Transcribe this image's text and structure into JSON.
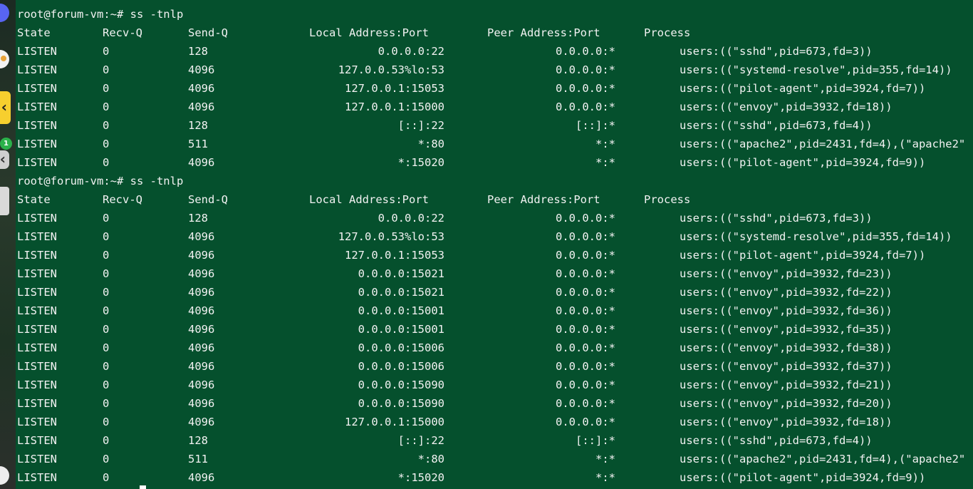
{
  "prompt": "root@forum-vm:~# ",
  "commands": [
    {
      "command": "ss -tnlp",
      "headers": [
        "State",
        "Recv-Q",
        "Send-Q",
        "Local Address:Port",
        "Peer Address:Port",
        "Process"
      ],
      "rows": [
        [
          "LISTEN",
          "0",
          "128",
          "0.0.0.0:22",
          "0.0.0.0:*",
          "users:((\"sshd\",pid=673,fd=3))"
        ],
        [
          "LISTEN",
          "0",
          "4096",
          "127.0.0.53%lo:53",
          "0.0.0.0:*",
          "users:((\"systemd-resolve\",pid=355,fd=14))"
        ],
        [
          "LISTEN",
          "0",
          "4096",
          "127.0.0.1:15053",
          "0.0.0.0:*",
          "users:((\"pilot-agent\",pid=3924,fd=7))"
        ],
        [
          "LISTEN",
          "0",
          "4096",
          "127.0.0.1:15000",
          "0.0.0.0:*",
          "users:((\"envoy\",pid=3932,fd=18))"
        ],
        [
          "LISTEN",
          "0",
          "128",
          "[::]:22",
          "[::]:*",
          "users:((\"sshd\",pid=673,fd=4))"
        ],
        [
          "LISTEN",
          "0",
          "511",
          "*:80",
          "*:*",
          "users:((\"apache2\",pid=2431,fd=4),(\"apache2\""
        ],
        [
          "LISTEN",
          "0",
          "4096",
          "*:15020",
          "*:*",
          "users:((\"pilot-agent\",pid=3924,fd=9))"
        ]
      ]
    },
    {
      "command": "ss -tnlp",
      "headers": [
        "State",
        "Recv-Q",
        "Send-Q",
        "Local Address:Port",
        "Peer Address:Port",
        "Process"
      ],
      "rows": [
        [
          "LISTEN",
          "0",
          "128",
          "0.0.0.0:22",
          "0.0.0.0:*",
          "users:((\"sshd\",pid=673,fd=3))"
        ],
        [
          "LISTEN",
          "0",
          "4096",
          "127.0.0.53%lo:53",
          "0.0.0.0:*",
          "users:((\"systemd-resolve\",pid=355,fd=14))"
        ],
        [
          "LISTEN",
          "0",
          "4096",
          "127.0.0.1:15053",
          "0.0.0.0:*",
          "users:((\"pilot-agent\",pid=3924,fd=7))"
        ],
        [
          "LISTEN",
          "0",
          "4096",
          "0.0.0.0:15021",
          "0.0.0.0:*",
          "users:((\"envoy\",pid=3932,fd=23))"
        ],
        [
          "LISTEN",
          "0",
          "4096",
          "0.0.0.0:15021",
          "0.0.0.0:*",
          "users:((\"envoy\",pid=3932,fd=22))"
        ],
        [
          "LISTEN",
          "0",
          "4096",
          "0.0.0.0:15001",
          "0.0.0.0:*",
          "users:((\"envoy\",pid=3932,fd=36))"
        ],
        [
          "LISTEN",
          "0",
          "4096",
          "0.0.0.0:15001",
          "0.0.0.0:*",
          "users:((\"envoy\",pid=3932,fd=35))"
        ],
        [
          "LISTEN",
          "0",
          "4096",
          "0.0.0.0:15006",
          "0.0.0.0:*",
          "users:((\"envoy\",pid=3932,fd=38))"
        ],
        [
          "LISTEN",
          "0",
          "4096",
          "0.0.0.0:15006",
          "0.0.0.0:*",
          "users:((\"envoy\",pid=3932,fd=37))"
        ],
        [
          "LISTEN",
          "0",
          "4096",
          "0.0.0.0:15090",
          "0.0.0.0:*",
          "users:((\"envoy\",pid=3932,fd=21))"
        ],
        [
          "LISTEN",
          "0",
          "4096",
          "0.0.0.0:15090",
          "0.0.0.0:*",
          "users:((\"envoy\",pid=3932,fd=20))"
        ],
        [
          "LISTEN",
          "0",
          "4096",
          "127.0.0.1:15000",
          "0.0.0.0:*",
          "users:((\"envoy\",pid=3932,fd=18))"
        ],
        [
          "LISTEN",
          "0",
          "128",
          "[::]:22",
          "[::]:*",
          "users:((\"sshd\",pid=673,fd=4))"
        ],
        [
          "LISTEN",
          "0",
          "511",
          "*:80",
          "*:*",
          "users:((\"apache2\",pid=2431,fd=4),(\"apache2\""
        ],
        [
          "LISTEN",
          "0",
          "4096",
          "*:15020",
          "*:*",
          "users:((\"pilot-agent\",pid=3924,fd=9))"
        ]
      ]
    }
  ],
  "dock": {
    "badge_count": "1",
    "icons": [
      "discord-icon",
      "chrome-icon",
      "app-icon",
      "extensions-icon",
      "file-icon",
      "ubuntu-icon"
    ]
  },
  "colors": {
    "terminal_bg": "#05502d",
    "terminal_fg": "#f2f2f2"
  }
}
